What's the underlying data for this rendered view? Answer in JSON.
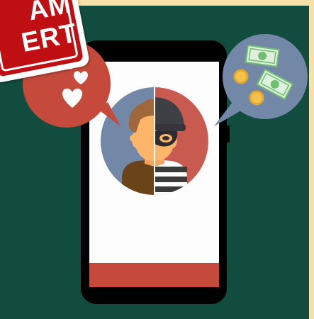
{
  "stamp": {
    "line1": "AM",
    "line2": "ERT"
  },
  "colors": {
    "background_cream": "#f8e1a6",
    "panel_green": "#124c3e",
    "stamp_red": "#bf0f12",
    "bubble_red": "#c54a3b",
    "bubble_blue": "#7387a7",
    "money_green": "#6fbf73",
    "coin_gold": "#e2a82a"
  },
  "icons": {
    "left_bubble": "hearts-icon",
    "right_bubble": "money-icon",
    "avatar_left": "man-icon",
    "avatar_right": "robber-icon"
  }
}
